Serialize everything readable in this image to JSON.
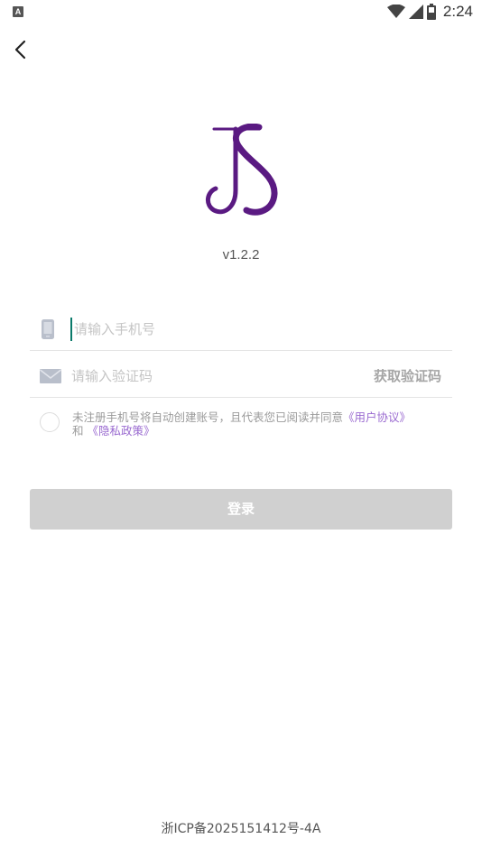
{
  "status_bar": {
    "left_icon": "A",
    "time": "2:24",
    "icons": [
      "notification-a-icon",
      "wifi-icon",
      "cell-signal-icon",
      "battery-icon"
    ]
  },
  "nav": {
    "back_icon": "chevron-left-icon"
  },
  "app": {
    "version": "v1.2.2"
  },
  "login_form": {
    "phone_placeholder": "请输入手机号",
    "phone_value": "",
    "code_placeholder": "请输入验证码",
    "code_value": "",
    "get_code_label": "获取验证码",
    "agreement_text": "未注册手机号将自动创建账号，且代表您已阅读并同意",
    "user_agreement_link": "《用户协议》",
    "and_text": "和",
    "privacy_policy_link": "《隐私政策》",
    "agreement_checked": false,
    "login_label": "登录"
  },
  "footer": {
    "icp": "浙ICP备2025151412号-4A"
  },
  "colors": {
    "brand_purple": "#5a1a82",
    "link_purple": "#9a6ad0",
    "button_disabled": "#d0d0d0",
    "icon_gray": "#b9bfcb"
  }
}
